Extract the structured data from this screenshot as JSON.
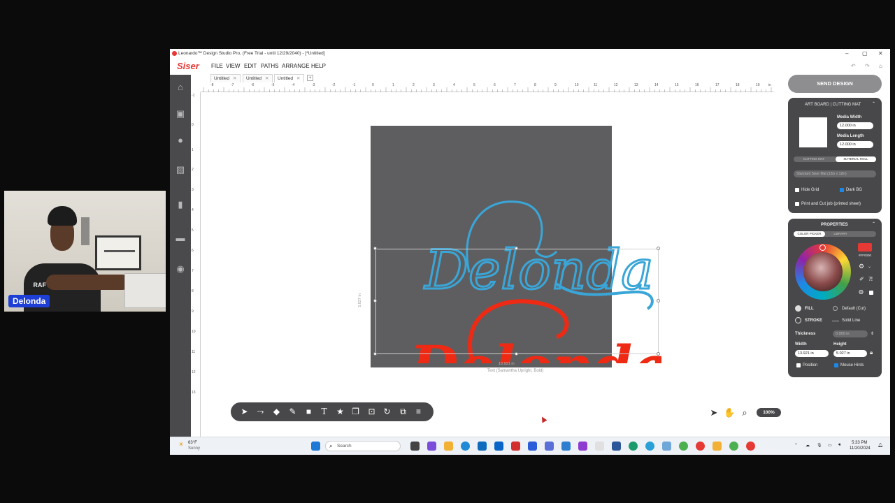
{
  "webcam": {
    "name_tag": "Delonda"
  },
  "window": {
    "title": "Leonardo™ Design Studio Pro, (Free Trial - until 12/29/2040) - [*Untitled]",
    "controls": [
      "–",
      "▢",
      "✕"
    ]
  },
  "menubar": {
    "brand": "Siser",
    "items": [
      "FILE",
      "VIEW",
      "EDIT",
      "PATHS",
      "ARRANGE",
      "HELP"
    ]
  },
  "tabs": [
    {
      "label": "Untitled"
    },
    {
      "label": "Untitled"
    },
    {
      "label": "Untitled"
    }
  ],
  "ruler": {
    "h_ticks": [
      "-8",
      "-7",
      "-6",
      "-5",
      "-4",
      "-3",
      "-2",
      "-1",
      "0",
      "1",
      "2",
      "3",
      "4",
      "5",
      "6",
      "7",
      "8",
      "9",
      "10",
      "11",
      "12",
      "13",
      "14",
      "15",
      "16",
      "17",
      "18",
      "19",
      "in"
    ],
    "v_ticks": [
      "-1",
      "0",
      "1",
      "2",
      "3",
      "4",
      "5",
      "6",
      "7",
      "8",
      "9",
      "10",
      "11",
      "12",
      "13"
    ]
  },
  "canvas": {
    "text_top": "Delonda",
    "text_bottom": "Delonda",
    "color_top": "#3aa6d8",
    "color_bottom": "#ef2a14",
    "width_dimension": "13.921 in",
    "height_dimension": "5.027 in",
    "font_caption": "Text (Samantha Upright, Bold)"
  },
  "toolbar": {
    "icons": [
      "select-icon",
      "node-edit-icon",
      "eraser-icon",
      "pen-icon",
      "rectangle-icon",
      "text-icon",
      "star-icon",
      "group-icon",
      "image-trace-icon",
      "offset-icon",
      "weld-icon",
      "align-icon"
    ]
  },
  "view_tools": {
    "zoom": "100%"
  },
  "right_panel": {
    "send_design": "SEND DESIGN",
    "artboard": {
      "header": "ART BOARD | CUTTING MAT",
      "media_width_label": "Media Width",
      "media_width": "12.000 in",
      "media_length_label": "Media Length",
      "media_length": "12.000 in",
      "mode_options": [
        "CUTTING MAT",
        "MATERIAL ROLL"
      ],
      "mat_select": "Standard Siser Mat (12in x 12in)",
      "hide_grid": "Hide Grid",
      "dark_bg": "Dark BG",
      "print_cut": "Print and Cut job (printed sheet)"
    },
    "properties": {
      "header": "PROPERTIES",
      "picker_tabs": [
        "COLOR PICKER",
        "LIBRARY"
      ],
      "hex": "#FF0000",
      "fill_label": "FILL",
      "fill_value": "Default (Cut)",
      "stroke_label": "STROKE",
      "stroke_value": "Solid Line",
      "thickness_label": "Thickness",
      "thickness_value": "0.000 in",
      "width_label": "Width",
      "width_value": "13.921 in",
      "height_label": "Height",
      "height_value": "5.027 in",
      "position_label": "Position",
      "mouse_hints_label": "Mouse Hints"
    }
  },
  "taskbar": {
    "weather_temp": "63°F",
    "weather_desc": "Sunny",
    "search_placeholder": "Search",
    "time": "5:33 PM",
    "date": "11/20/2024"
  }
}
